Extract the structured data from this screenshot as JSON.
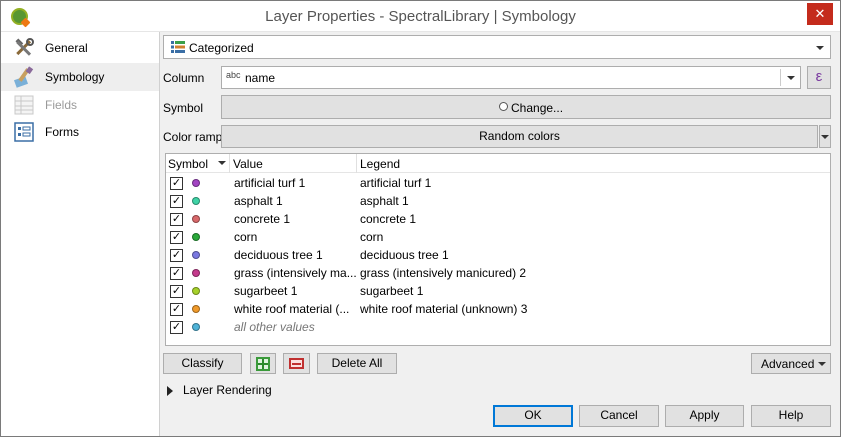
{
  "window": {
    "title": "Layer Properties - SpectralLibrary | Symbology",
    "close_glyph": "✕"
  },
  "sidebar": {
    "items": [
      {
        "label": "General",
        "icon": "tools-icon",
        "enabled": true
      },
      {
        "label": "Symbology",
        "icon": "paintbrush-icon",
        "enabled": true,
        "selected": true
      },
      {
        "label": "Fields",
        "icon": "fields-table-icon",
        "enabled": false
      },
      {
        "label": "Forms",
        "icon": "forms-icon",
        "enabled": true
      }
    ]
  },
  "renderer": {
    "selected": "Categorized"
  },
  "column": {
    "label": "Column",
    "type_badge": "abc",
    "value": "name",
    "expression_glyph": "ε"
  },
  "symbol": {
    "label": "Symbol",
    "button_label": "Change..."
  },
  "color_ramp": {
    "label": "Color ramp",
    "value": "Random colors"
  },
  "categories": {
    "headers": {
      "symbol": "Symbol",
      "value": "Value",
      "legend": "Legend"
    },
    "rows": [
      {
        "checked": true,
        "color": "#a244c2",
        "value": "artificial turf 1",
        "legend": "artificial turf 1"
      },
      {
        "checked": true,
        "color": "#3fd3a6",
        "value": "asphalt 1",
        "legend": "asphalt 1"
      },
      {
        "checked": true,
        "color": "#d8686a",
        "value": "concrete 1",
        "legend": "concrete 1"
      },
      {
        "checked": true,
        "color": "#2aa83a",
        "value": "corn",
        "legend": "corn"
      },
      {
        "checked": true,
        "color": "#7a78e0",
        "value": "deciduous tree 1",
        "legend": "deciduous tree 1"
      },
      {
        "checked": true,
        "color": "#c43a8c",
        "value": "grass (intensively ma...",
        "legend": "grass (intensively manicured) 2"
      },
      {
        "checked": true,
        "color": "#a6d12a",
        "value": "sugarbeet 1",
        "legend": "sugarbeet 1"
      },
      {
        "checked": true,
        "color": "#f09a2a",
        "value": "white roof material (...",
        "legend": "white roof material (unknown) 3"
      },
      {
        "checked": true,
        "color": "#4fb3d8",
        "value": "all other values",
        "legend": "",
        "muted": true
      }
    ]
  },
  "actions": {
    "classify": "Classify",
    "delete_all": "Delete All",
    "advanced": "Advanced"
  },
  "layer_rendering": {
    "label": "Layer Rendering"
  },
  "footer": {
    "ok": "OK",
    "cancel": "Cancel",
    "apply": "Apply",
    "help": "Help"
  }
}
